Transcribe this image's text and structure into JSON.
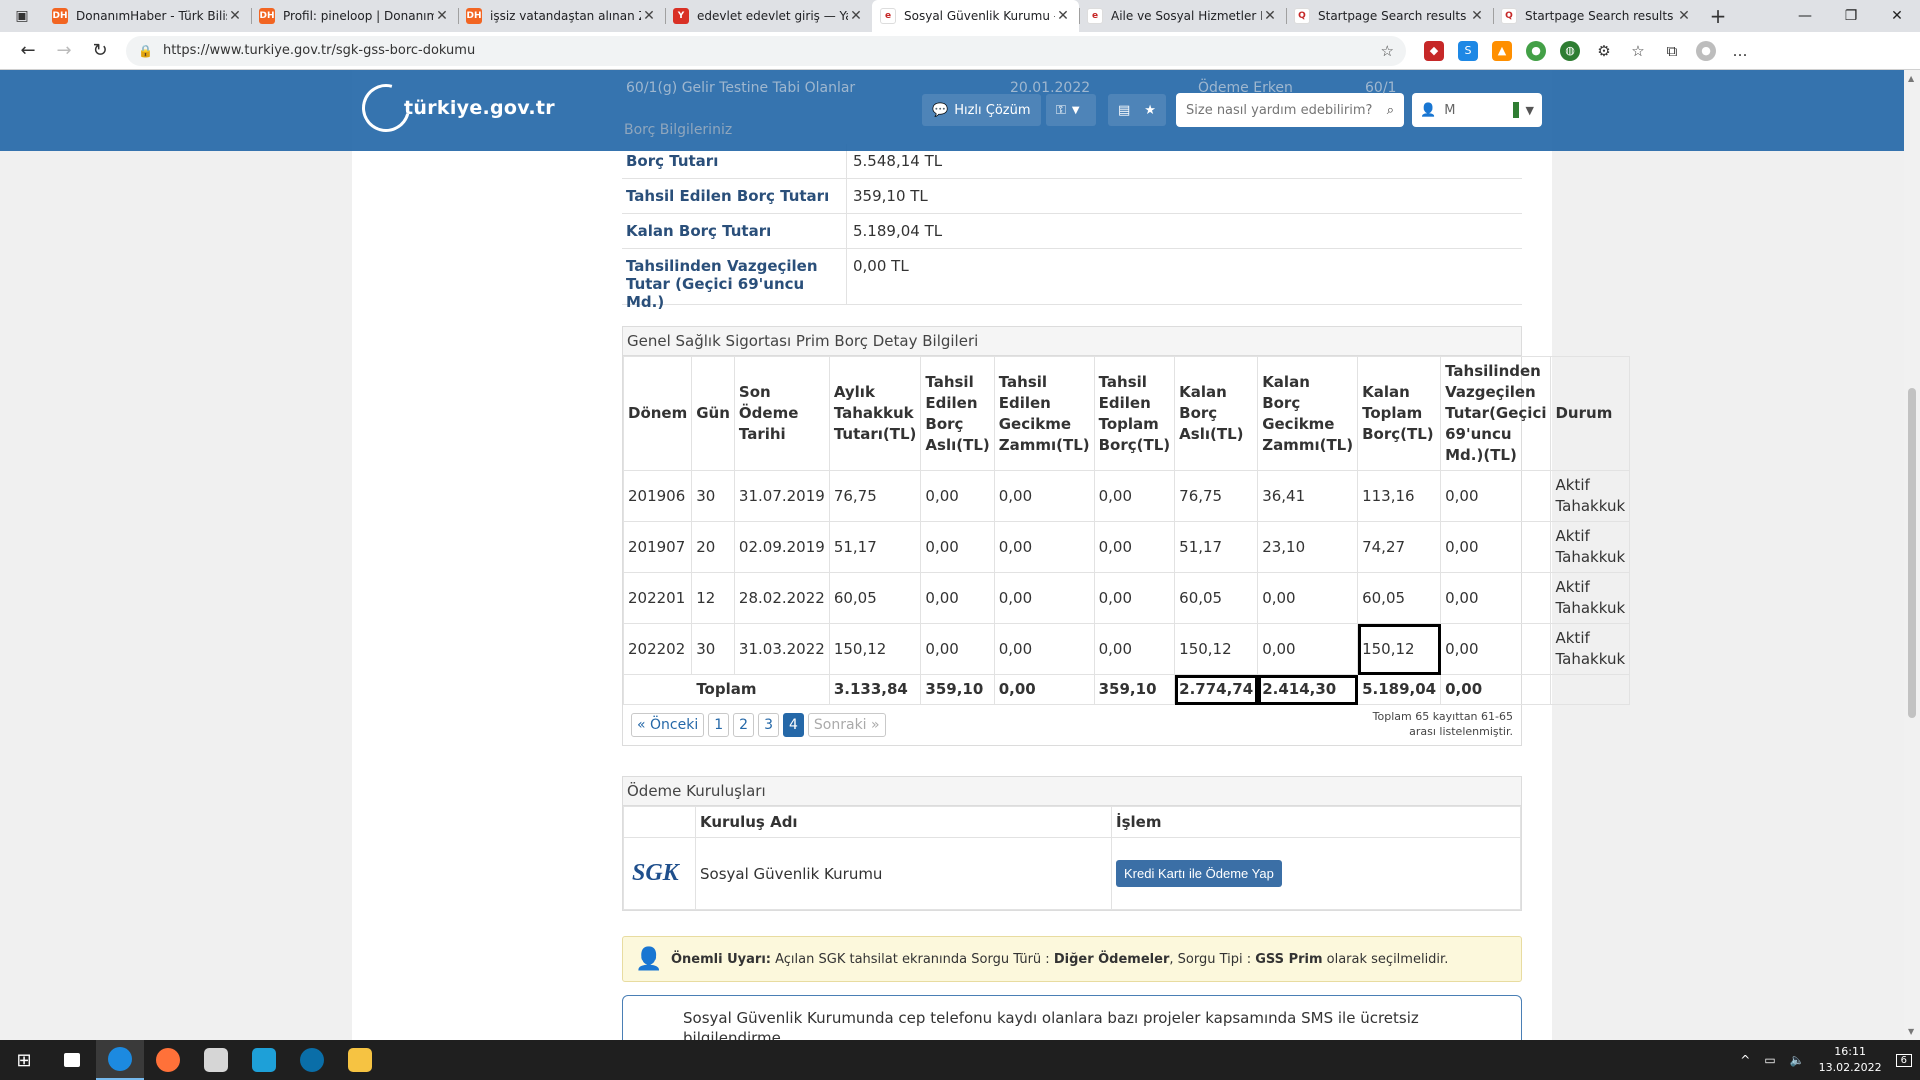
{
  "browser": {
    "tabs": [
      {
        "title": "DonanımHaber - Türk Bilişi",
        "favicon": "DH",
        "color": "#f26522",
        "active": false
      },
      {
        "title": "Profil: pineloop | Donanım",
        "favicon": "DH",
        "color": "#f26522",
        "active": false
      },
      {
        "title": "işsiz vatandaştan alınan Zo",
        "favicon": "DH",
        "color": "#f26522",
        "active": false
      },
      {
        "title": "edevlet edevlet giriş — Yan",
        "favicon": "Y",
        "color": "#d93025",
        "active": false
      },
      {
        "title": "Sosyal Güvenlik Kurumu -",
        "favicon": "e",
        "color": "#ffffff",
        "active": true
      },
      {
        "title": "Aile ve Sosyal Hizmetler Ba",
        "favicon": "e",
        "color": "#ffffff",
        "active": false
      },
      {
        "title": "Startpage Search results",
        "favicon": "Q",
        "color": "#ffffff",
        "active": false
      },
      {
        "title": "Startpage Search results",
        "favicon": "Q",
        "color": "#ffffff",
        "active": false
      }
    ],
    "new_tab": "+",
    "url": "https://www.turkiye.gov.tr/sgk-gss-borc-dokumu"
  },
  "header": {
    "logo_text": "türkiye.gov.tr",
    "quick_solution": "Hızlı Çözüm",
    "search_placeholder": "Size nasıl yardım edebilirim?",
    "user_initial": "M"
  },
  "ghost": {
    "row1_label": "60/1(g) Gelir Testine Tabi Olanlar",
    "row1_date": "20.01.2022",
    "row1_status": "Ödeme Erken",
    "row1_extra": "60/1",
    "section_title": "Borç Bilgileriniz"
  },
  "summary": [
    {
      "label": "Borç Tutarı",
      "value": "5.548,14 TL"
    },
    {
      "label": "Tahsil Edilen Borç Tutarı",
      "value": "359,10 TL"
    },
    {
      "label": "Kalan Borç Tutarı",
      "value": "5.189,04 TL"
    },
    {
      "label": "Tahsilinden Vazgeçilen Tutar (Geçici 69'uncu Md.)",
      "value": "0,00 TL"
    }
  ],
  "detail": {
    "title": "Genel Sağlık Sigortası Prim Borç Detay Bilgileri",
    "headers": [
      "Dönem",
      "Gün",
      "Son Ödeme Tarihi",
      "Aylık Tahakkuk Tutarı(TL)",
      "Tahsil Edilen Borç Aslı(TL)",
      "Tahsil Edilen Gecikme Zammı(TL)",
      "Tahsil Edilen Toplam Borç(TL)",
      "Kalan Borç Aslı(TL)",
      "Kalan Borç Gecikme Zammı(TL)",
      "Kalan Toplam Borç(TL)",
      "Tahsilinden Vazgeçilen Tutar(Geçici 69'uncu Md.)(TL)",
      "Durum"
    ],
    "rows": [
      [
        "201906",
        "30",
        "31.07.2019",
        "76,75",
        "0,00",
        "0,00",
        "0,00",
        "76,75",
        "36,41",
        "113,16",
        "0,00",
        "Aktif Tahakkuk"
      ],
      [
        "201907",
        "20",
        "02.09.2019",
        "51,17",
        "0,00",
        "0,00",
        "0,00",
        "51,17",
        "23,10",
        "74,27",
        "0,00",
        "Aktif Tahakkuk"
      ],
      [
        "202201",
        "12",
        "28.02.2022",
        "60,05",
        "0,00",
        "0,00",
        "0,00",
        "60,05",
        "0,00",
        "60,05",
        "0,00",
        "Aktif Tahakkuk"
      ],
      [
        "202202",
        "30",
        "31.03.2022",
        "150,12",
        "0,00",
        "0,00",
        "0,00",
        "150,12",
        "0,00",
        "150,12",
        "0,00",
        "Aktif Tahakkuk"
      ]
    ],
    "total": {
      "label": "Toplam",
      "values": [
        "3.133,84",
        "359,10",
        "0,00",
        "359,10",
        "2.774,74",
        "2.414,30",
        "5.189,04",
        "0,00"
      ]
    },
    "pager": {
      "prev": "« Önceki",
      "pages": [
        "1",
        "2",
        "3",
        "4"
      ],
      "current": "4",
      "next": "Sonraki »"
    },
    "pager_info": "Toplam 65 kayıttan 61-65 arası listelenmiştir."
  },
  "payment": {
    "title": "Ödeme Kuruluşları",
    "col_name": "Kuruluş Adı",
    "col_action": "İşlem",
    "logo_text": "SGK",
    "org_name": "Sosyal Güvenlik Kurumu",
    "button": "Kredi Kartı ile Ödeme Yap"
  },
  "warning": {
    "prefix": "Önemli Uyarı:",
    "text1": " Açılan SGK tahsilat ekranında Sorgu Türü : ",
    "bold1": "Diğer Ödemeler",
    "text2": ", Sorgu Tipi : ",
    "bold2": "GSS Prim",
    "text3": " olarak seçilmelidir."
  },
  "info": {
    "text": "Sosyal Güvenlik Kurumunda cep telefonu kaydı olanlara bazı projeler kapsamında SMS ile ücretsiz bilgilendirme"
  },
  "taskbar": {
    "time": "16:11",
    "date": "13.02.2022",
    "notif_count": "6"
  }
}
